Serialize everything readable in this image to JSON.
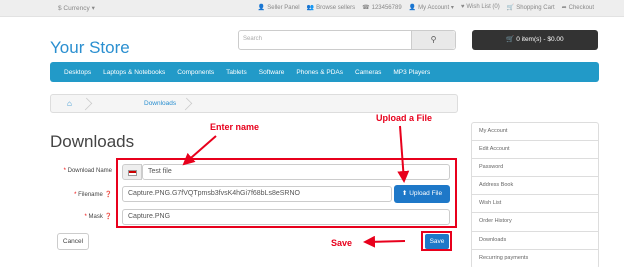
{
  "topbar": {
    "currency": "$ Currency ▾",
    "links": [
      {
        "icon": "user-icon",
        "label": "Seller Panel"
      },
      {
        "icon": "users-icon",
        "label": "Browse sellers"
      },
      {
        "icon": "phone-icon",
        "label": "123456789"
      },
      {
        "icon": "account-icon",
        "label": "My Account ▾"
      },
      {
        "icon": "heart-icon",
        "label": "Wish List (0)"
      },
      {
        "icon": "cart-icon",
        "label": "Shopping Cart"
      },
      {
        "icon": "checkout-icon",
        "label": "Checkout"
      }
    ]
  },
  "header": {
    "logo": "Your Store",
    "search_placeholder": "Search",
    "cart_label": "🛒 0 item(s) - $0.00"
  },
  "menu": [
    "Desktops",
    "Laptops & Notebooks",
    "Components",
    "Tablets",
    "Software",
    "Phones & PDAs",
    "Cameras",
    "MP3 Players"
  ],
  "breadcrumb": {
    "home_icon": "home-icon",
    "current": "Downloads"
  },
  "page_title": "Downloads",
  "form": {
    "download_name_label": "Download Name",
    "download_name_value": "Test file",
    "filename_label": "Filename",
    "filename_value": "Capture.PNG.G7fVQTpmsb3fvsK4hGi7f68bLs8eSRNO",
    "mask_label": "Mask",
    "mask_value": "Capture.PNG",
    "upload_label": "Upload File",
    "cancel_label": "Cancel",
    "save_label": "Save"
  },
  "annotations": {
    "enter_name": "Enter name",
    "upload_file": "Upload a File",
    "save": "Save",
    "color": "#e8001c"
  },
  "sidebar": [
    "My Account",
    "Edit Account",
    "Password",
    "Address Book",
    "Wish List",
    "Order History",
    "Downloads",
    "Recurring payments"
  ]
}
